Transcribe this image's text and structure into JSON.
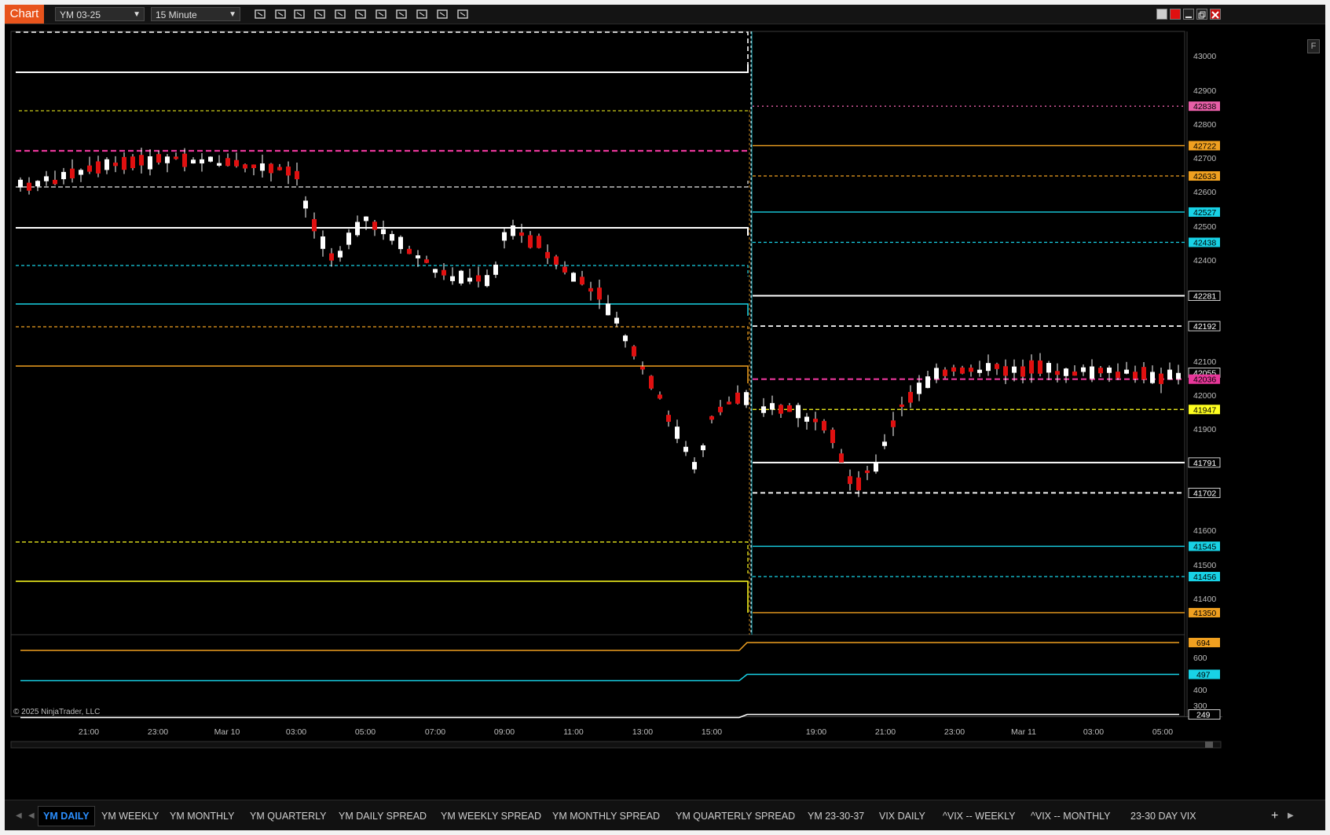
{
  "window": {
    "title": "Chart",
    "instrument": "YM 03-25",
    "interval": "15 Minute",
    "f_button": "F",
    "accent": "#e8541c"
  },
  "toolbar_icons": [
    "bar-type-icon",
    "pencil-draw-icon",
    "zoom-in-icon",
    "zoom-out-icon",
    "pointer-icon",
    "data-box-icon",
    "properties-icon",
    "indicators-icon",
    "strategies-icon",
    "templates-icon",
    "list-icon"
  ],
  "chart": {
    "copyright": "© 2025 NinjaTrader, LLC",
    "price_axis": [
      "43000",
      "42900",
      "42800",
      "42700",
      "42600",
      "42500",
      "42400",
      "42200",
      "42100",
      "42000",
      "41900",
      "41600",
      "41500",
      "41400"
    ],
    "markers": [
      {
        "value": "42838",
        "color": "#e85fa8"
      },
      {
        "value": "42722",
        "color": "#f0a020"
      },
      {
        "value": "42633",
        "color": "#f0a020"
      },
      {
        "value": "42527",
        "color": "#18d2e6"
      },
      {
        "value": "42438",
        "color": "#18d2e6"
      },
      {
        "value": "42281",
        "color": "#ffffff"
      },
      {
        "value": "42192",
        "color": "#ffffff"
      },
      {
        "value": "42055",
        "color": "#ffffff"
      },
      {
        "value": "42036",
        "color": "#e8379a"
      },
      {
        "value": "41947",
        "color": "#ffff20"
      },
      {
        "value": "41791",
        "color": "#ffffff"
      },
      {
        "value": "41702",
        "color": "#ffffff"
      },
      {
        "value": "41545",
        "color": "#18d2e6"
      },
      {
        "value": "41456",
        "color": "#18d2e6"
      },
      {
        "value": "41350",
        "color": "#f0a020"
      }
    ],
    "lower_axis": [
      "600",
      "400",
      "300"
    ],
    "lower_markers": [
      {
        "value": "694",
        "color": "#f0a020"
      },
      {
        "value": "497",
        "color": "#18d2e6"
      },
      {
        "value": "249",
        "color": "#ffffff"
      }
    ],
    "time_axis": [
      "21:00",
      "23:00",
      "Mar 10",
      "03:00",
      "05:00",
      "07:00",
      "09:00",
      "11:00",
      "13:00",
      "15:00",
      "19:00",
      "21:00",
      "23:00",
      "Mar 11",
      "03:00",
      "05:00"
    ]
  },
  "tabs": [
    "YM DAILY",
    "YM WEEKLY",
    "YM MONTHLY",
    "YM QUARTERLY",
    "YM DAILY SPREAD",
    "YM WEEKLY SPREAD",
    "YM MONTHLY SPREAD",
    "YM QUARTERLY SPREAD",
    "YM 23-30-37",
    "VIX DAILY",
    "^VIX -- WEEKLY",
    "^VIX -- MONTHLY",
    "23-30 DAY VIX"
  ],
  "active_tab": "YM DAILY",
  "add_tab": "+"
}
